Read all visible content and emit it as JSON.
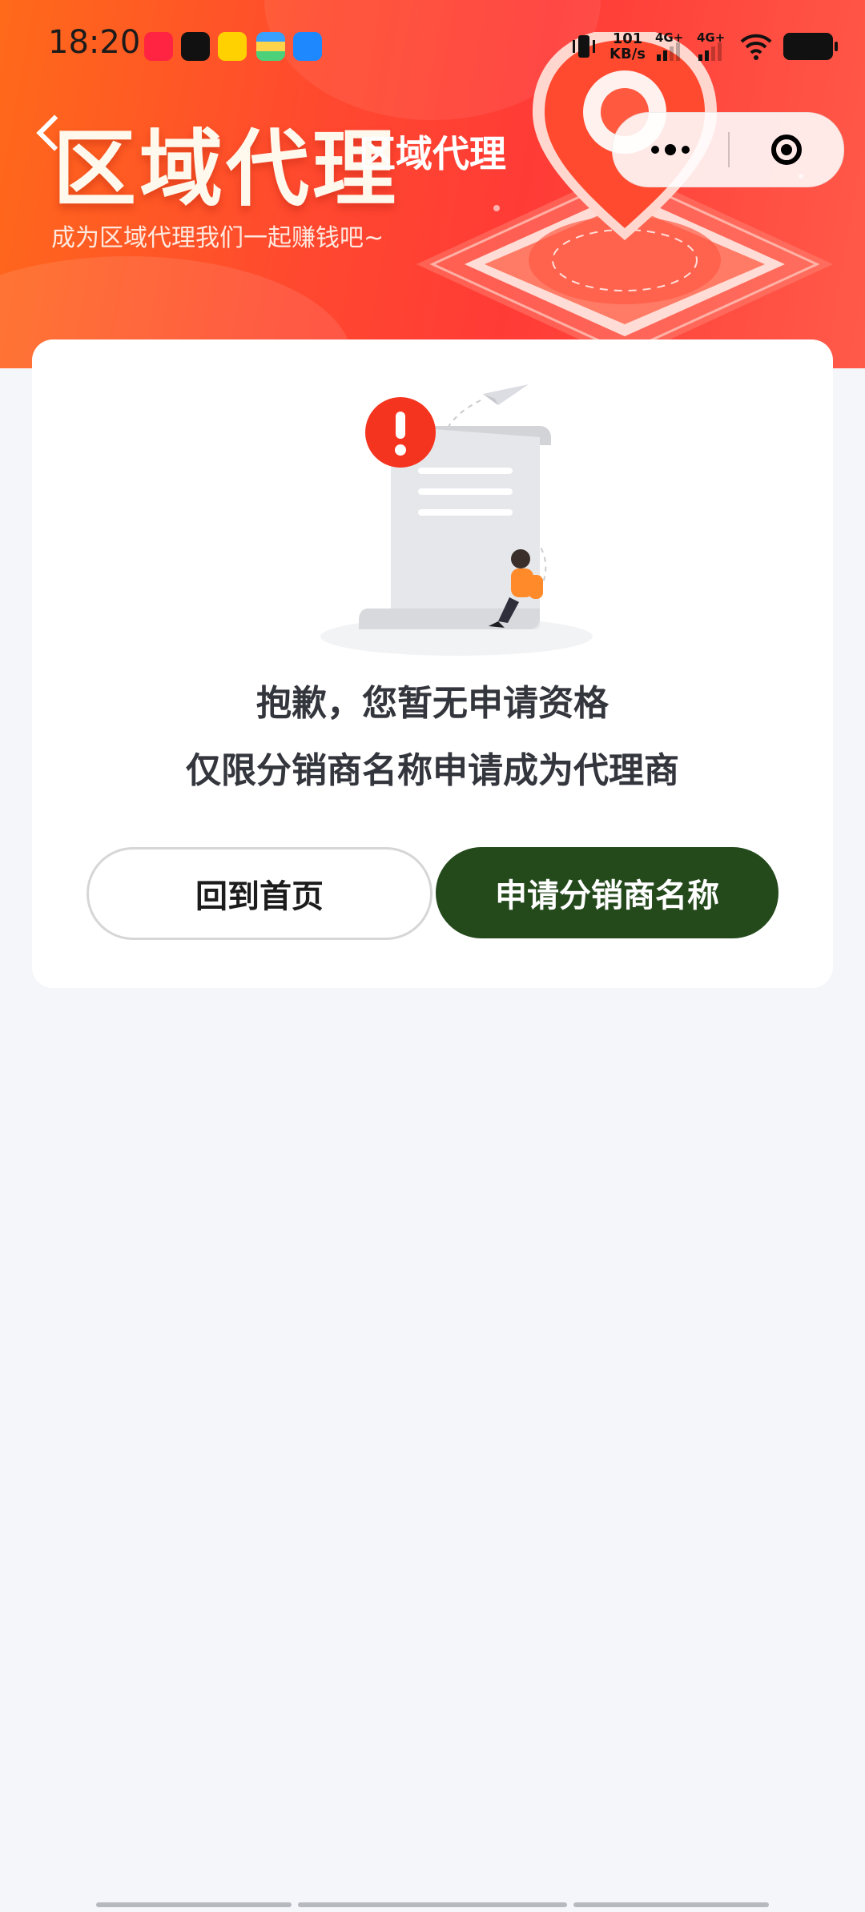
{
  "status_bar": {
    "time": "18:20",
    "app_icons": [
      {
        "name": "xiaohongshu-app-icon",
        "color": "#ff2442"
      },
      {
        "name": "douyin-app-icon",
        "color": "#111111"
      },
      {
        "name": "meituan-app-icon",
        "color": "#ffd100"
      },
      {
        "name": "wallet-app-icon",
        "color": "#3aa0ff"
      },
      {
        "name": "message-app-icon",
        "color": "#1e88ff"
      }
    ],
    "net_speed_value": "101",
    "net_speed_unit": "KB/s",
    "sim1_label": "4G+",
    "sim2_label": "4G+"
  },
  "header": {
    "banner_title": "区域代理",
    "nav_title": "区域代理",
    "subtitle": "成为区域代理我们一起赚钱吧~"
  },
  "content": {
    "message_line1": "抱歉，您暂无申请资格",
    "message_line2": "仅限分销商名称申请成为代理商",
    "back_home_button": "回到首页",
    "apply_button": "申请分销商名称"
  },
  "colors": {
    "banner_orange": "#ff6a1a",
    "banner_red": "#ff3b36",
    "apply_button": "#244a1c",
    "page_background": "#f5f6fa",
    "alert_badge": "#f5341f"
  }
}
